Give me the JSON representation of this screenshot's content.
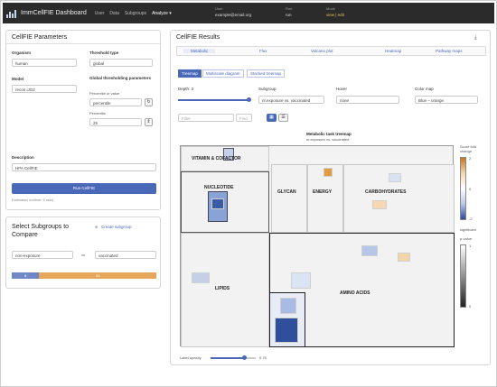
{
  "app": {
    "title": "ImmCellFIE Dashboard",
    "logo_icon": "bar-chart-logo-icon"
  },
  "nav": {
    "items": [
      "User",
      "Data",
      "Subgroups",
      "Analyze ▾"
    ]
  },
  "user": {
    "id_key": "User",
    "id_val": "example@email.org",
    "run_key": "Run",
    "run_val": "run",
    "mode_key": "Mode",
    "mode_val": "view | edit"
  },
  "params": {
    "title": "CellFIE Parameters",
    "organism_label": "Organism",
    "organism_value": "human",
    "threshold_label": "Threshold type",
    "threshold_value": "global",
    "model_label": "Model",
    "model_value": "recon iJO2",
    "global_label": "Global thresholding parameters",
    "pct_label": "Percentile or value",
    "pct_value": "percentile",
    "pctile_label": "Percentile",
    "pctile_value": "25",
    "desc_label": "Description",
    "desc_value": "HPA CellFIE",
    "run_button": "Run CellFIE",
    "est_time": "Estimated runtime: 5 mins"
  },
  "subgroups": {
    "title": "Select Subgroups to Compare",
    "create_link": "Create subgroup",
    "left": "non-exposure",
    "vs": "vs.",
    "right": "vaccinated",
    "left_count": "8",
    "right_count": "34"
  },
  "results": {
    "title": "CellFIE Results",
    "tabs": [
      "Metabolic",
      "Flux",
      "Volcano plot",
      "Heatmap",
      "Pathway maps"
    ],
    "viewtabs": [
      "Treemap",
      "Multiscale diagram",
      "Stacked treemap"
    ],
    "depth_label": "Depth: 3",
    "subgroup_label": "Subgroup",
    "subgroup_value": "nr.exposure vs. vaccinated",
    "hover_label": "Hover",
    "hover_value": "none",
    "colormap_label": "Color map",
    "colormap_value": "Blue – orange",
    "filter_placeholder": "Filter",
    "filter_side": "Find",
    "treemap_title": "Metabolic task treemap",
    "treemap_sub": "nr.exposure vs. vaccinated",
    "groups": [
      "VITAMIN & COFACTOR",
      "NUCLEOTIDE",
      "GLYCAN",
      "ENERGY",
      "CARBOHYDRATES",
      "LIPIDS",
      "AMINO ACIDS"
    ],
    "legend_title": "Score fold change",
    "legend_top": "2",
    "legend_bottom": "-2",
    "legend_mid": "0",
    "legend_sig": "significant",
    "legend2_title": "p-value",
    "legend2_top": "1",
    "legend2_bottom": "0",
    "opacity_label": "Label opacity",
    "opacity_value": "0.75"
  },
  "colors": {
    "accent": "#4a68b8",
    "orange": "#e8a24a",
    "dark": "#2b2b2b"
  }
}
